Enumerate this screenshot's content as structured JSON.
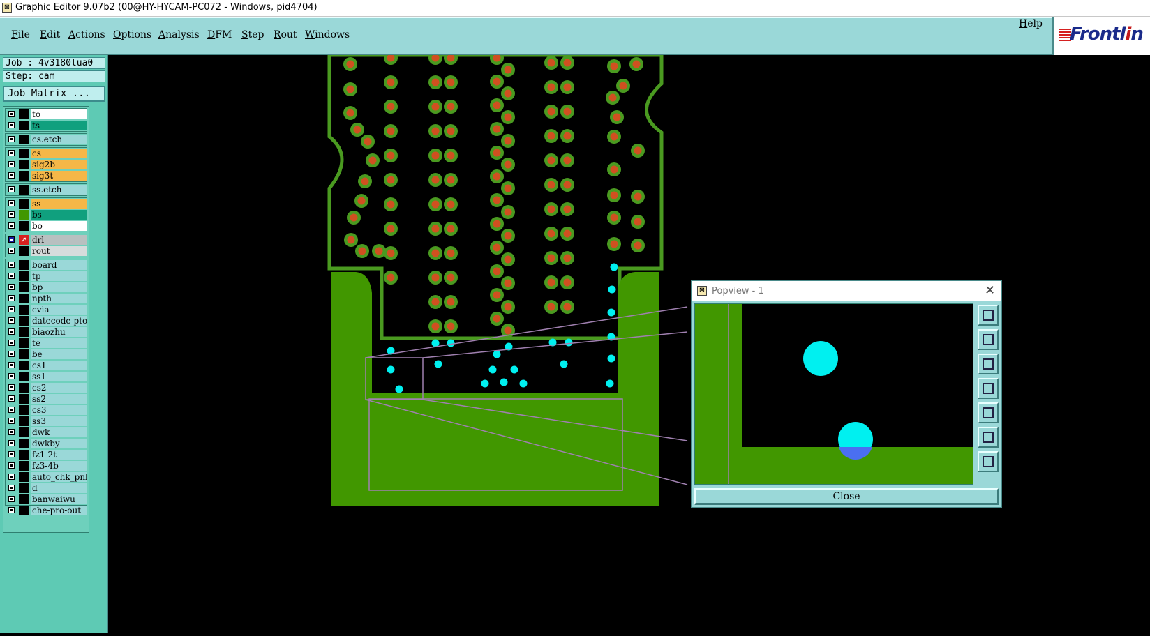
{
  "window": {
    "title": "Graphic Editor 9.07b2 (00@HY-HYCAM-PC072 - Windows, pid4704)"
  },
  "menu": {
    "items": [
      "File",
      "Edit",
      "Actions",
      "Options",
      "Analysis",
      "DFM",
      "Step",
      "Rout",
      "Windows"
    ],
    "help": "Help"
  },
  "logo": {
    "text_a": "Frontl",
    "text_b": "i",
    "text_c": "n"
  },
  "left": {
    "job": "Job : 4v3180lua0",
    "step": "Step: cam",
    "job_matrix": "Job Matrix ..."
  },
  "layers": [
    {
      "name": "to",
      "style": "white"
    },
    {
      "name": "ts",
      "style": "teal"
    },
    {
      "name": "cs.etch",
      "style": "plain"
    },
    {
      "name": "cs",
      "style": "orange"
    },
    {
      "name": "sig2b",
      "style": "orange"
    },
    {
      "name": "sig3t",
      "style": "orange"
    },
    {
      "name": "ss.etch",
      "style": "plain"
    },
    {
      "name": "ss",
      "style": "orange"
    },
    {
      "name": "bs",
      "style": "teal"
    },
    {
      "name": "bo",
      "style": "white"
    },
    {
      "name": "drl",
      "style": "grey"
    },
    {
      "name": "rout",
      "style": "lgrey"
    },
    {
      "name": "board",
      "style": "plain"
    },
    {
      "name": "tp",
      "style": "plain"
    },
    {
      "name": "bp",
      "style": "plain"
    },
    {
      "name": "npth",
      "style": "plain"
    },
    {
      "name": "cvia",
      "style": "plain"
    },
    {
      "name": "datecode-pto",
      "style": "plain"
    },
    {
      "name": "biaozhu",
      "style": "plain"
    },
    {
      "name": "te",
      "style": "plain"
    },
    {
      "name": "be",
      "style": "plain"
    },
    {
      "name": "cs1",
      "style": "plain"
    },
    {
      "name": "ss1",
      "style": "plain"
    },
    {
      "name": "cs2",
      "style": "plain"
    },
    {
      "name": "ss2",
      "style": "plain"
    },
    {
      "name": "cs3",
      "style": "plain"
    },
    {
      "name": "ss3",
      "style": "plain"
    },
    {
      "name": "dwk",
      "style": "plain"
    },
    {
      "name": "dwkby",
      "style": "plain"
    },
    {
      "name": "fz1-2t",
      "style": "plain"
    },
    {
      "name": "fz3-4b",
      "style": "plain"
    },
    {
      "name": "auto_chk_pnl",
      "style": "plain"
    },
    {
      "name": "d",
      "style": "plain"
    },
    {
      "name": "banwaiwu",
      "style": "plain"
    },
    {
      "name": "che-pro-out",
      "style": "plain"
    }
  ],
  "popview": {
    "title": "Popview - 1",
    "close_label": "Close"
  },
  "colors": {
    "board": "#419700",
    "pad_ring": "#4a9a20",
    "pad_core": "#d05020",
    "drill": "#00f0f0",
    "frame": "#a080b0"
  }
}
